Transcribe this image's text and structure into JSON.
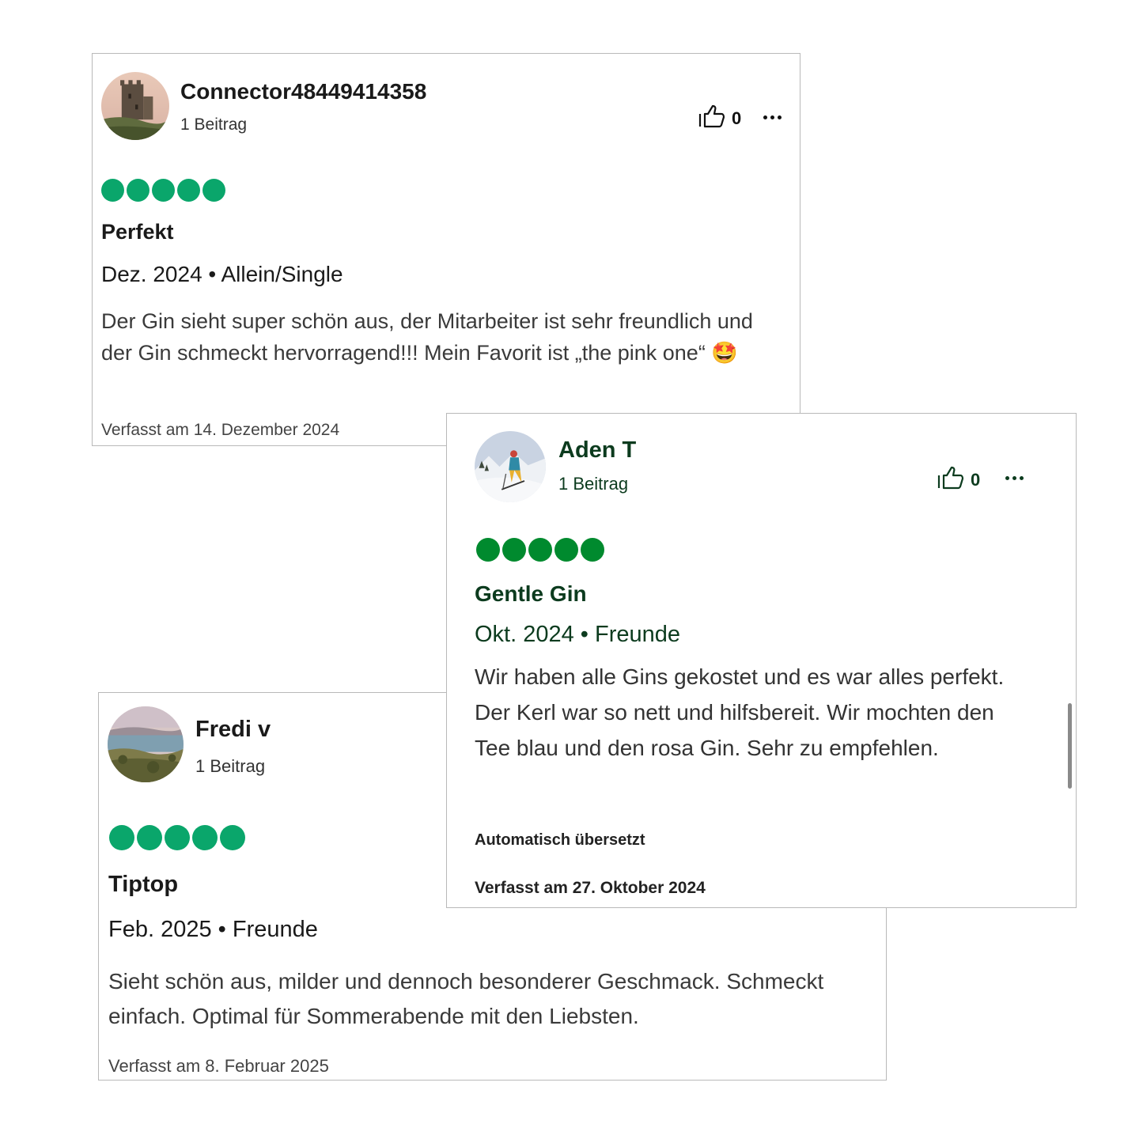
{
  "reviews": [
    {
      "username": "Connector48449414358",
      "contributions": "1 Beitrag",
      "helpful_count": "0",
      "rating": 5,
      "title": "Perfekt",
      "trip": "Dez. 2024 • Allein/Single",
      "text": "Der Gin sieht super schön aus, der Mitarbeiter ist sehr freundlich und der Gin schmeckt hervorragend!!! Mein Favorit ist „the pink one“ 🤩",
      "written": "Verfasst am 14. Dezember 2024",
      "rating_color": "#0aa66b",
      "avatar": "castle-photo"
    },
    {
      "username": "Aden T",
      "contributions": "1 Beitrag",
      "helpful_count": "0",
      "rating": 5,
      "title": "Gentle Gin",
      "trip": "Okt. 2024 • Freunde",
      "text": "Wir haben alle Gins gekostet und es war alles perfekt. Der Kerl war so nett und hilfsbereit. Wir mochten den Tee blau und den rosa Gin. Sehr zu empfehlen.",
      "auto_translated": "Automatisch übersetzt",
      "written": "Verfasst am 27. Oktober 2024",
      "rating_color": "#008a2e",
      "avatar": "skier-photo"
    },
    {
      "username": "Fredi v",
      "contributions": "1 Beitrag",
      "rating": 5,
      "title": "Tiptop",
      "trip": "Feb. 2025 • Freunde",
      "text": "Sieht schön aus, milder und dennoch besonderer Geschmack. Schmeckt einfach. Optimal für Sommerabende mit den Liebsten.",
      "written": "Verfasst am 8. Februar 2025",
      "rating_color": "#0aa66b",
      "avatar": "coast-photo"
    }
  ]
}
